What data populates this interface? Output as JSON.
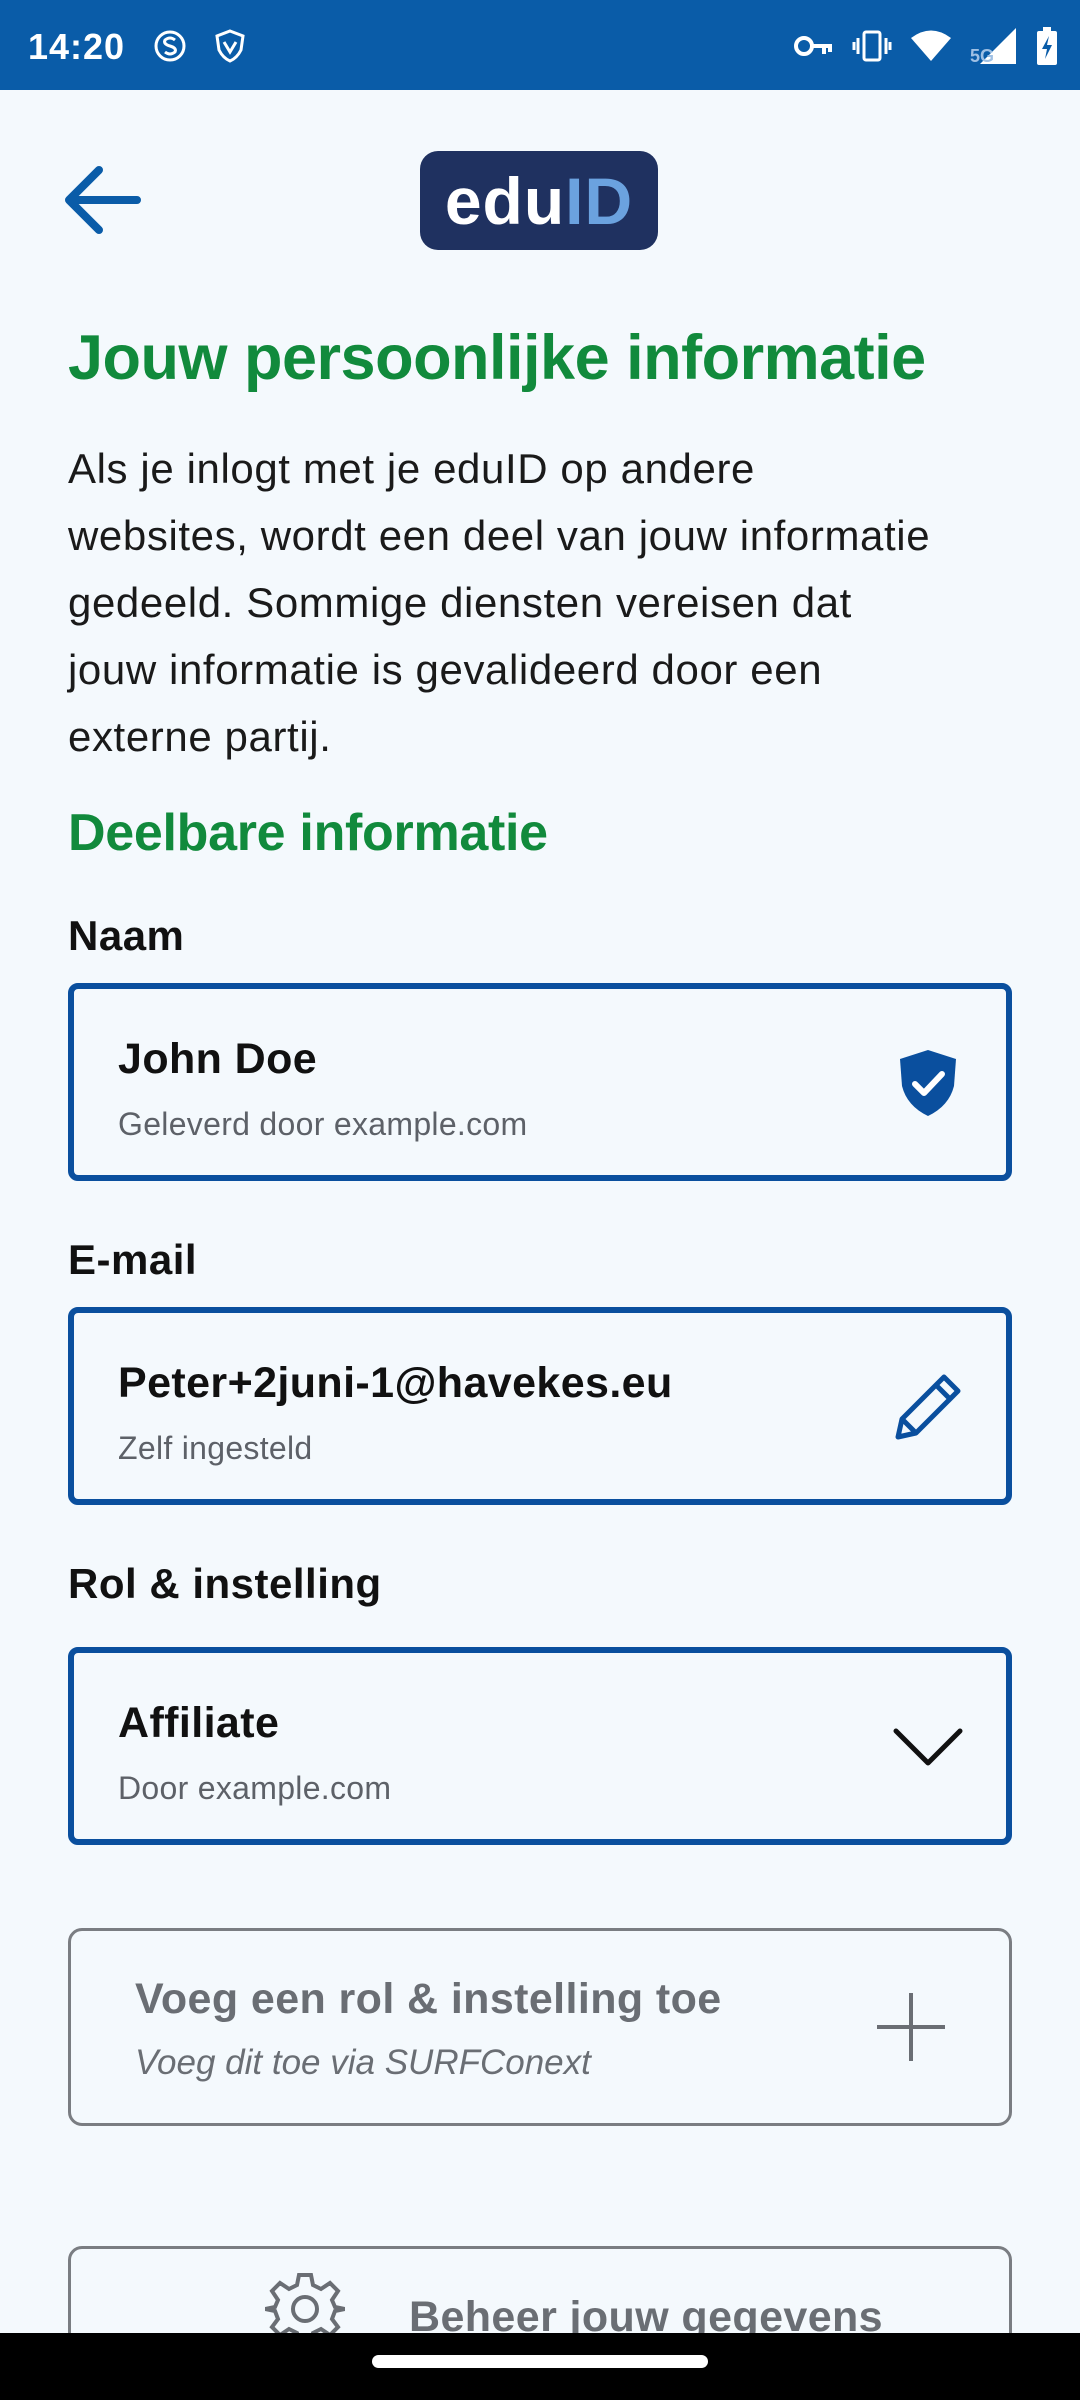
{
  "status_bar": {
    "time": "14:20",
    "icons_left": [
      "s-circle-icon",
      "shield-app-icon"
    ],
    "icons_right": [
      "key-icon",
      "vibrate-icon",
      "wifi-icon",
      "signal-5g-icon",
      "battery-charging-icon"
    ],
    "network_label": "5G"
  },
  "header": {
    "logo_edu": "edu",
    "logo_id": "ID"
  },
  "page": {
    "title": "Jouw persoonlijke informatie",
    "intro_lines": [
      "Als je inlogt met je eduID op andere",
      "websites, wordt een deel van jouw informatie",
      "gedeeld. Sommige diensten vereisen dat",
      "jouw informatie is gevalideerd door een",
      "externe partij."
    ],
    "section_title": "Deelbare informatie"
  },
  "fields": {
    "name": {
      "label": "Naam",
      "value": "John Doe",
      "sub": "Geleverd door example.com",
      "icon": "verified-shield-icon"
    },
    "email": {
      "label": "E-mail",
      "value": "Peter+2juni-1@havekes.eu",
      "sub": "Zelf ingesteld",
      "icon": "pencil-icon"
    },
    "role": {
      "label": "Rol & instelling",
      "value": "Affiliate",
      "sub": "Door example.com",
      "icon": "chevron-down-icon"
    }
  },
  "add_role": {
    "title": "Voeg een rol & instelling toe",
    "sub": "Voeg dit toe via SURFConext",
    "icon": "plus-icon"
  },
  "manage": {
    "label": "Beheer jouw gegevens",
    "icon": "gear-icon"
  },
  "colors": {
    "status_bar": "#0a5ca8",
    "accent_blue": "#0a4f9e",
    "title_green": "#118a3c",
    "logo_bg": "#1f3160",
    "logo_id": "#6ba2df",
    "background": "#f4f9fd"
  }
}
